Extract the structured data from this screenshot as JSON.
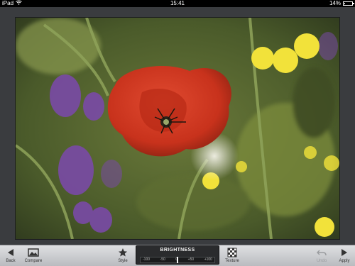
{
  "status_bar": {
    "carrier": "iPad",
    "time": "15:41",
    "battery_text": "14%",
    "battery_level": 0.14
  },
  "toolbar": {
    "back_label": "Back",
    "compare_label": "Compare",
    "style_label": "Style",
    "texture_label": "Texture",
    "undo_label": "Undo",
    "apply_label": "Apply"
  },
  "adjustment": {
    "title": "BRIGHTNESS",
    "scale_ticks": [
      "-100",
      "-50",
      "0",
      "+50",
      "+100"
    ],
    "value": 0
  },
  "colors": {
    "toolbar": "#c9cbce",
    "panel": "#2a2b2d",
    "frame": "#3a3c3f"
  }
}
